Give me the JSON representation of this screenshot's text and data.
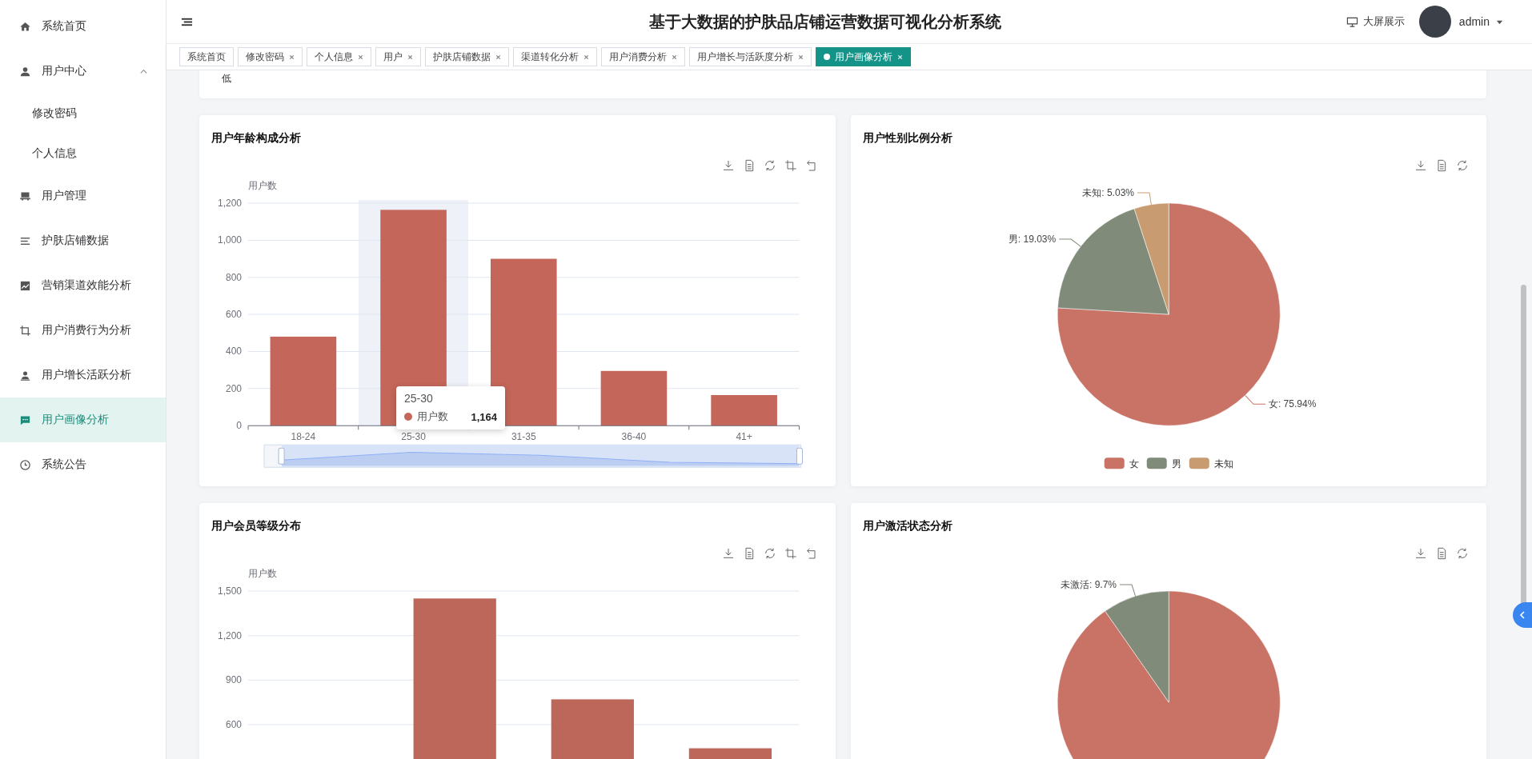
{
  "header": {
    "title": "基于大数据的护肤品店铺运营数据可视化分析系统",
    "screen_button": "大屏展示",
    "user": "admin"
  },
  "sidebar": {
    "items": [
      {
        "label": "系统首页",
        "selected": false
      },
      {
        "label": "用户中心",
        "selected": false,
        "expanded": true,
        "children": [
          {
            "label": "修改密码",
            "selected": false
          },
          {
            "label": "个人信息",
            "selected": false
          }
        ]
      },
      {
        "label": "用户管理",
        "selected": false
      },
      {
        "label": "护肤店铺数据",
        "selected": false
      },
      {
        "label": "营销渠道效能分析",
        "selected": false
      },
      {
        "label": "用户消费行为分析",
        "selected": false
      },
      {
        "label": "用户增长活跃分析",
        "selected": false
      },
      {
        "label": "用户画像分析",
        "selected": true
      },
      {
        "label": "系统公告",
        "selected": false
      }
    ]
  },
  "tabs": [
    {
      "label": "系统首页",
      "selected": false,
      "closable": false
    },
    {
      "label": "修改密码",
      "selected": false,
      "closable": true
    },
    {
      "label": "个人信息",
      "selected": false,
      "closable": true
    },
    {
      "label": "用户",
      "selected": false,
      "closable": true
    },
    {
      "label": "护肤店铺数据",
      "selected": false,
      "closable": true
    },
    {
      "label": "渠道转化分析",
      "selected": false,
      "closable": true
    },
    {
      "label": "用户消费分析",
      "selected": false,
      "closable": true
    },
    {
      "label": "用户增长与活跃度分析",
      "selected": false,
      "closable": true
    },
    {
      "label": "用户画像分析",
      "selected": true,
      "closable": true
    }
  ],
  "top_card": {
    "text": "低"
  },
  "cards": [
    {
      "title": "用户年龄构成分析",
      "toolbox": [
        {
          "kind": "download"
        },
        {
          "kind": "dataview"
        },
        {
          "kind": "refresh"
        },
        {
          "kind": "zoom"
        },
        {
          "kind": "reset"
        }
      ],
      "data_zoom": true,
      "tooltip": {
        "title": "25-30",
        "series": "用户数",
        "value": "1,164"
      },
      "chart_data": {
        "type": "bar",
        "ylabel": "用户数",
        "categories": [
          "18-24",
          "25-30",
          "31-35",
          "36-40",
          "41+"
        ],
        "series": [
          {
            "color": "#c4665a",
            "values": [
              480,
              1164,
              900,
              295,
              165
            ]
          }
        ],
        "ylim": [
          0,
          1200
        ],
        "grid": true,
        "yticks": [
          0,
          200,
          400,
          600,
          800,
          {
            "value": 1000,
            "label": "1,000"
          },
          {
            "value": 1200,
            "label": "1,200"
          }
        ]
      }
    },
    {
      "title": "用户性别比例分析",
      "toolbox": [
        {
          "kind": "download"
        },
        {
          "kind": "dataview"
        },
        {
          "kind": "refresh"
        }
      ],
      "data_zoom": false,
      "chart_data": {
        "type": "pie",
        "categories": [
          "女",
          "男",
          "未知"
        ],
        "values": [
          75.94,
          19.03,
          5.03
        ],
        "colors": [
          "#c87366",
          "#818b7a",
          "#c99b70"
        ],
        "value_labels": [
          "女: 75.94%",
          "男: 19.03%",
          "未知: 5.03%"
        ],
        "legend": true
      }
    },
    {
      "title": "用户会员等级分布",
      "toolbox": [
        {
          "kind": "download"
        },
        {
          "kind": "dataview"
        },
        {
          "kind": "refresh"
        },
        {
          "kind": "zoom"
        },
        {
          "kind": "reset"
        }
      ],
      "data_zoom": false,
      "chart_data": {
        "type": "bar",
        "ylabel": "用户数",
        "series": [
          {
            "color": "#bd665a",
            "values": [
              null,
              1450,
              770,
              440
            ]
          }
        ],
        "ylim": [
          0,
          1500
        ],
        "grid": true,
        "yticks": [
          600,
          900,
          {
            "value": 1200,
            "label": "1,200"
          },
          {
            "value": 1500,
            "label": "1,500"
          }
        ]
      }
    },
    {
      "title": "用户激活状态分析",
      "toolbox": [
        {
          "kind": "download"
        },
        {
          "kind": "dataview"
        },
        {
          "kind": "refresh"
        }
      ],
      "data_zoom": false,
      "chart_data": {
        "type": "pie",
        "values": [
          90.3,
          9.7
        ],
        "colors": [
          "#c87366",
          "#818b7a"
        ],
        "value_labels": [
          null,
          "未激活: 9.7%"
        ]
      }
    }
  ]
}
